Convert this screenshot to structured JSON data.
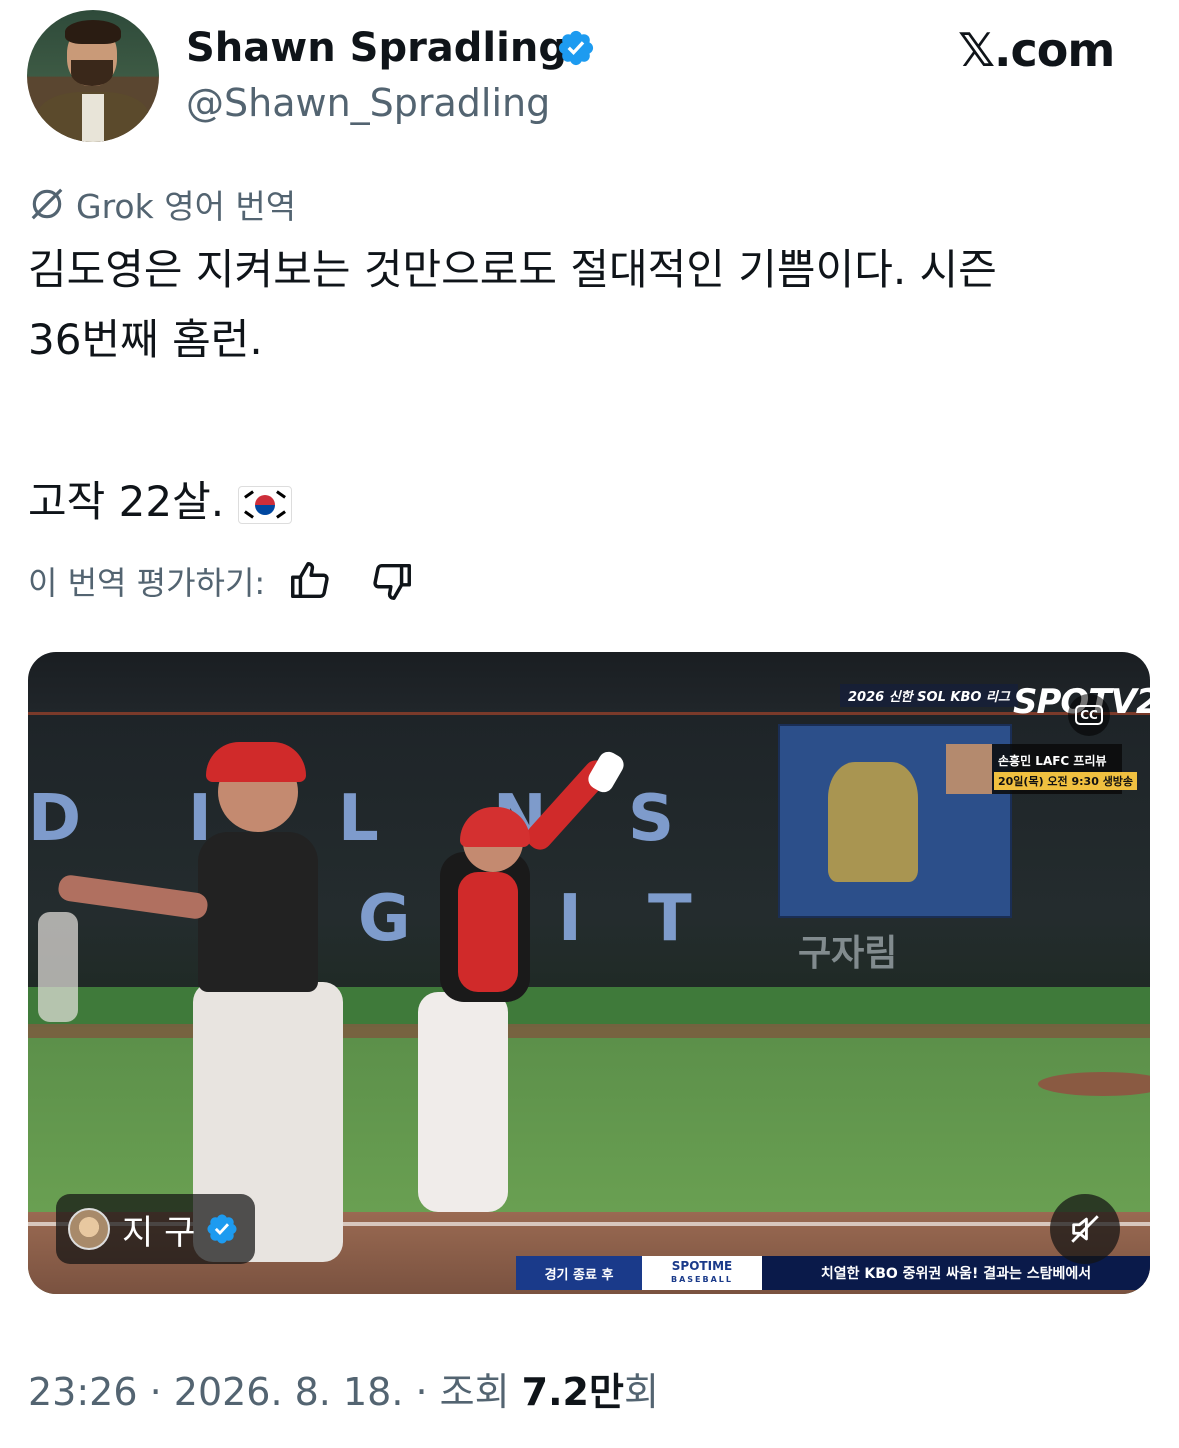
{
  "author": {
    "name": "Shawn Spradling",
    "handle": "@Shawn_Spradling",
    "verified_icon": "verified-badge-icon",
    "verified_color": "#1d9bf0"
  },
  "brand": "𝕏.com",
  "translation": {
    "label": "Grok 영어 번역",
    "icon": "grok-icon"
  },
  "tweet": {
    "line1": "김도영은 지켜보는 것만으로도 절대적인 기쁨이다. 시즌",
    "line2": "36번째 홈런.",
    "line3": "고작 22살.",
    "flag_icon": "south-korea-flag-icon"
  },
  "rating": {
    "label": "이 번역 평가하기:",
    "up_icon": "thumbs-up-icon",
    "down_icon": "thumbs-down-icon"
  },
  "video": {
    "broadcast_bug": "2026 신한 SOL KBO 리그",
    "channel": "SPOTV2",
    "cc_label": "CC",
    "promo_title": "손흥민 LAFC 프리뷰",
    "promo_time": "20일(목) 오전 9:30 생방송",
    "ticker_left": "경기 종료 후",
    "ticker_mid": "SPOTIME",
    "ticker_mid_sub": "BASEBALL",
    "ticker_right": "치열한 KBO 중위권 싸움! 결과는 스탐베에서",
    "stadium_sign": "구자림",
    "origin_account": "지 구",
    "mute_icon": "muted-speaker-icon"
  },
  "meta": {
    "time": "23:26",
    "date": "2026. 8. 18.",
    "views_prefix": "조회",
    "views_count": "7.2만",
    "views_suffix": "회"
  }
}
